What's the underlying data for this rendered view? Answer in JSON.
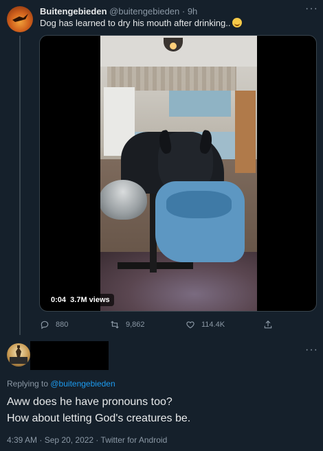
{
  "original_tweet": {
    "display_name": "Buitengebieden",
    "handle": "@buitengebieden",
    "age": "· 9h",
    "text": "Dog has learned to dry his mouth after drinking..",
    "emoji": "smiling-face-emoji",
    "video": {
      "elapsed": "0:04",
      "views": "3.7M views"
    },
    "actions": {
      "replies": "880",
      "retweets": "9,862",
      "likes": "114.4K"
    }
  },
  "reply_tweet": {
    "replying_prefix": "Replying to ",
    "replying_to": "@buitengebieden",
    "text_line1": "Aww does he have pronouns too?",
    "text_line2": "How about letting God's creatures be.",
    "meta": "4:39 AM · Sep 20, 2022 · Twitter for Android"
  },
  "icons": [
    "reply-icon",
    "retweet-icon",
    "like-icon",
    "share-icon",
    "more-icon"
  ],
  "colors": {
    "background": "#15202b",
    "accent": "#1d9bf0",
    "secondary_text": "#8b98a5",
    "primary_text": "#e7e9ea"
  }
}
